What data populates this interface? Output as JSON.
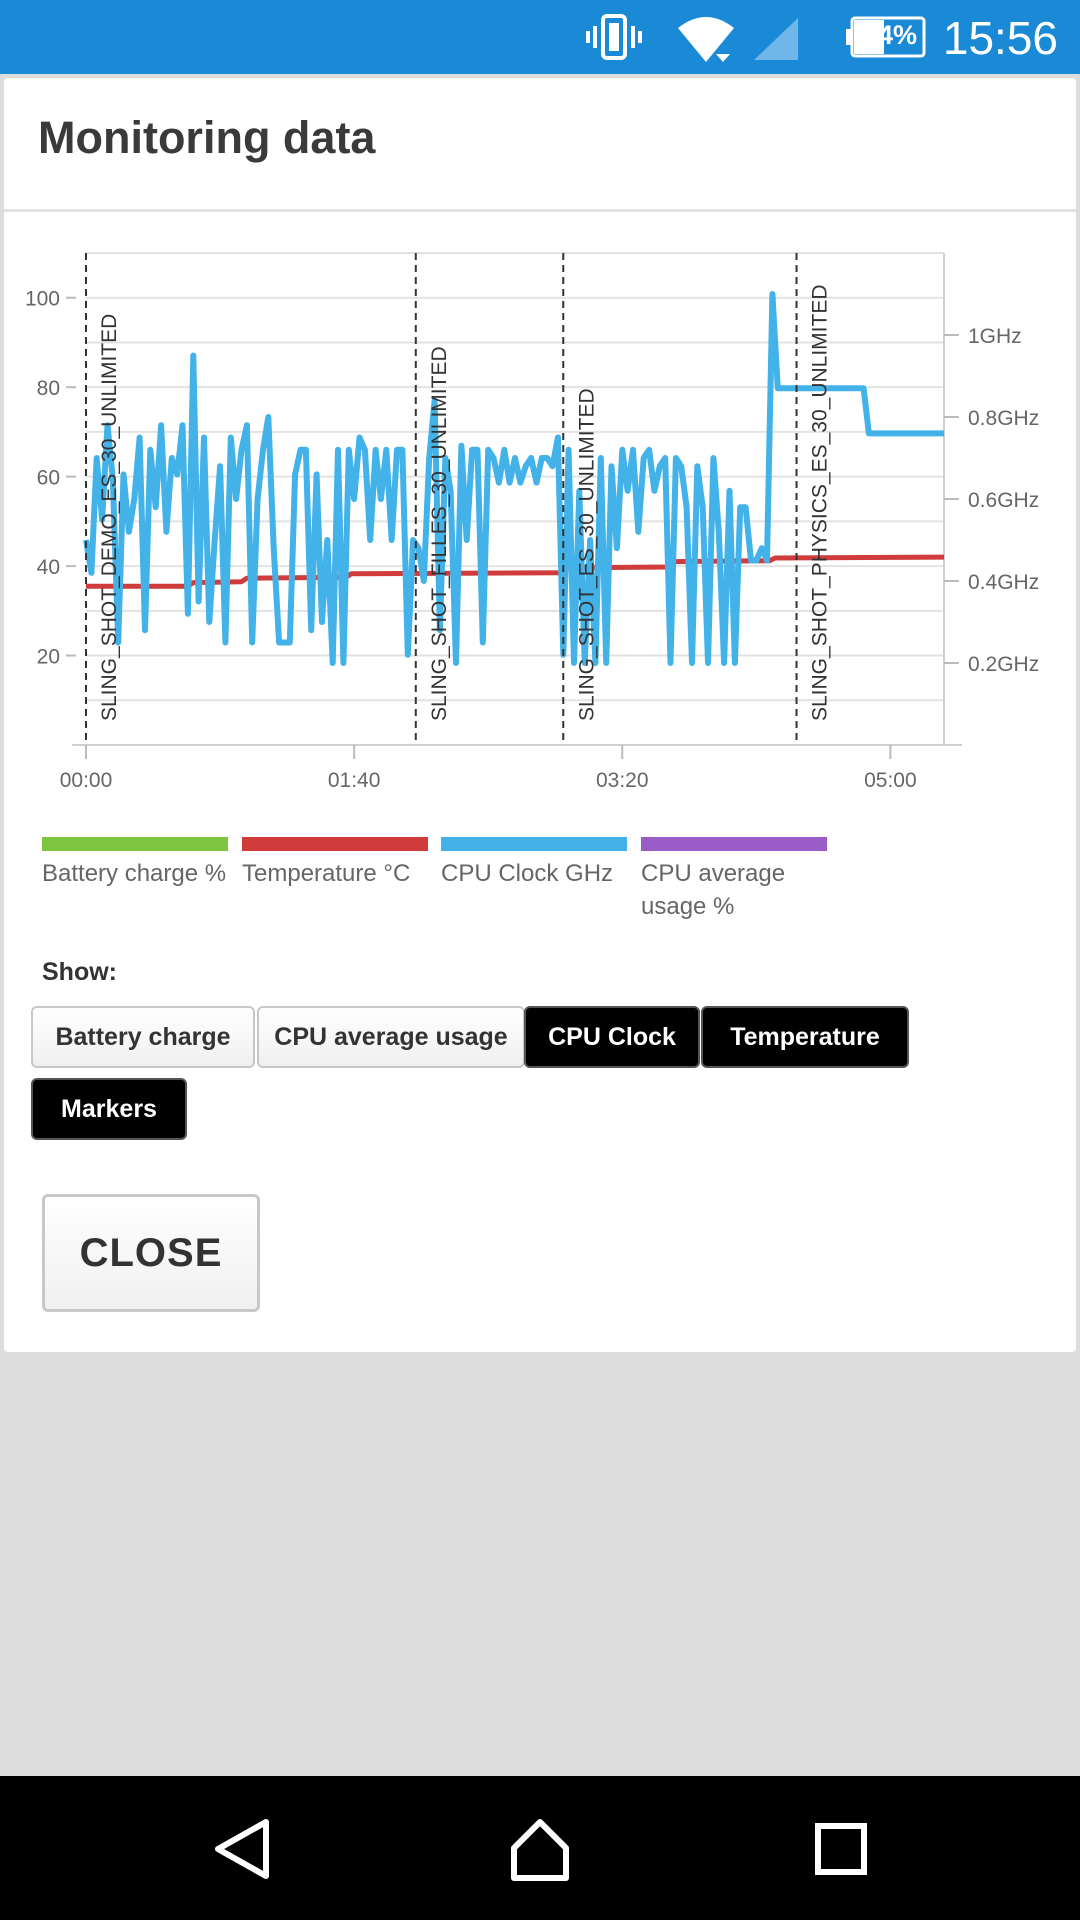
{
  "status_bar": {
    "battery_percent": "44%",
    "time": "15:56",
    "icons": [
      "vibrate-icon",
      "wifi-icon",
      "cell-signal-icon",
      "battery-icon"
    ]
  },
  "dialog": {
    "title": "Monitoring data",
    "close_label": "CLOSE"
  },
  "chart_data": {
    "type": "line",
    "x_ticks": [
      "00:00",
      "01:40",
      "03:20",
      "05:00"
    ],
    "x_range_seconds": [
      0,
      320
    ],
    "y_left_ticks": [
      "100",
      "80",
      "60",
      "40",
      "20"
    ],
    "y_left_range": [
      0,
      110
    ],
    "y_right_ticks": [
      "1GHz",
      "0.8GHz",
      "0.6GHz",
      "0.4GHz",
      "0.2GHz"
    ],
    "y_right_range_ghz": [
      0,
      1.2
    ],
    "grid": true,
    "markers": [
      {
        "t": 0,
        "label": "SLING_SHOT_DEMO_ES_30_UNLIMITED"
      },
      {
        "t": 123,
        "label": "SLING_SHOT_FILLES_30_UNLIMITED"
      },
      {
        "t": 178,
        "label": "SLING_SHOT_ES_30_UNLIMITED"
      },
      {
        "t": 265,
        "label": "SLING_SHOT_PHYSICS_ES_30_UNLIMITED"
      }
    ],
    "series": [
      {
        "name": "Temperature °C",
        "color": "#d03b3b",
        "x": [
          0,
          38,
          40,
          58,
          60,
          97,
          99,
          177,
          179,
          217,
          219,
          255,
          257,
          320
        ],
        "values": [
          35.5,
          35.5,
          36.3,
          36.5,
          37.3,
          37.5,
          38.3,
          38.5,
          39.6,
          39.8,
          41,
          41.2,
          41.8,
          42
        ]
      },
      {
        "name": "CPU Clock GHz",
        "color": "#42b2e9",
        "x": [
          0,
          2,
          4,
          6,
          8,
          10,
          12,
          14,
          16,
          18,
          20,
          22,
          24,
          26,
          28,
          30,
          32,
          34,
          36,
          38,
          40,
          42,
          44,
          46,
          48,
          50,
          52,
          54,
          56,
          58,
          60,
          62,
          64,
          66,
          68,
          70,
          72,
          74,
          76,
          78,
          80,
          82,
          84,
          86,
          88,
          90,
          92,
          94,
          96,
          98,
          100,
          102,
          104,
          106,
          108,
          110,
          112,
          114,
          116,
          118,
          120,
          122,
          124,
          126,
          128,
          130,
          132,
          134,
          136,
          138,
          140,
          142,
          144,
          146,
          148,
          150,
          152,
          154,
          156,
          158,
          160,
          162,
          164,
          166,
          168,
          170,
          172,
          174,
          176,
          178,
          180,
          182,
          184,
          186,
          188,
          190,
          192,
          194,
          196,
          198,
          200,
          202,
          204,
          206,
          208,
          210,
          212,
          214,
          216,
          218,
          220,
          222,
          224,
          226,
          228,
          230,
          232,
          234,
          236,
          238,
          240,
          242,
          244,
          246,
          248,
          250,
          252,
          254,
          256,
          258,
          260,
          262,
          264,
          266,
          268,
          270,
          272,
          274,
          276,
          278,
          280,
          282,
          284,
          286,
          288,
          290,
          292,
          294,
          296,
          298,
          300,
          302,
          304,
          306,
          308,
          310,
          312,
          314,
          316,
          318,
          320
        ],
        "values": [
          0.5,
          0.42,
          0.7,
          0.55,
          0.78,
          0.65,
          0.25,
          0.66,
          0.52,
          0.6,
          0.75,
          0.28,
          0.72,
          0.58,
          0.78,
          0.52,
          0.7,
          0.66,
          0.78,
          0.32,
          0.95,
          0.35,
          0.75,
          0.3,
          0.5,
          0.68,
          0.25,
          0.75,
          0.6,
          0.72,
          0.78,
          0.25,
          0.6,
          0.72,
          0.8,
          0.48,
          0.25,
          0.25,
          0.25,
          0.66,
          0.72,
          0.72,
          0.28,
          0.66,
          0.3,
          0.5,
          0.2,
          0.72,
          0.2,
          0.72,
          0.6,
          0.75,
          0.72,
          0.5,
          0.72,
          0.6,
          0.72,
          0.5,
          0.72,
          0.72,
          0.22,
          0.5,
          0.48,
          0.4,
          0.7,
          0.84,
          0.28,
          0.7,
          0.62,
          0.2,
          0.73,
          0.5,
          0.72,
          0.72,
          0.25,
          0.72,
          0.7,
          0.64,
          0.72,
          0.64,
          0.7,
          0.64,
          0.68,
          0.7,
          0.64,
          0.7,
          0.7,
          0.68,
          0.75,
          0.22,
          0.72,
          0.2,
          0.62,
          0.2,
          0.5,
          0.2,
          0.7,
          0.2,
          0.68,
          0.48,
          0.72,
          0.62,
          0.72,
          0.52,
          0.7,
          0.72,
          0.62,
          0.68,
          0.7,
          0.2,
          0.7,
          0.68,
          0.58,
          0.2,
          0.68,
          0.58,
          0.2,
          0.7,
          0.52,
          0.2,
          0.62,
          0.2,
          0.58,
          0.58,
          0.45,
          0.45,
          0.48,
          0.45,
          1.1,
          0.87,
          0.87,
          0.87,
          0.87,
          0.87,
          0.87,
          0.87,
          0.87,
          0.87,
          0.87,
          0.87,
          0.87,
          0.87,
          0.87,
          0.87,
          0.87,
          0.87,
          0.76,
          0.76,
          0.76,
          0.76,
          0.76,
          0.76,
          0.76,
          0.76,
          0.76,
          0.76,
          0.76,
          0.76,
          0.76,
          0.76,
          0.76
        ]
      }
    ]
  },
  "legend": [
    {
      "label": "Battery charge %",
      "color": "#7dc43f"
    },
    {
      "label": "Temperature °C",
      "color": "#d03b3b"
    },
    {
      "label": "CPU Clock GHz",
      "color": "#42b2e9"
    },
    {
      "label": "CPU average usage %",
      "color": "#9a5cc7"
    }
  ],
  "show": {
    "label": "Show:",
    "toggles": [
      {
        "label": "Battery charge",
        "on": false
      },
      {
        "label": "CPU average usage",
        "on": false
      },
      {
        "label": "CPU Clock",
        "on": true
      },
      {
        "label": "Temperature",
        "on": true
      },
      {
        "label": "Markers",
        "on": true
      }
    ]
  },
  "nav_bar": {
    "icons": [
      "back-icon",
      "home-icon",
      "recents-icon"
    ]
  }
}
